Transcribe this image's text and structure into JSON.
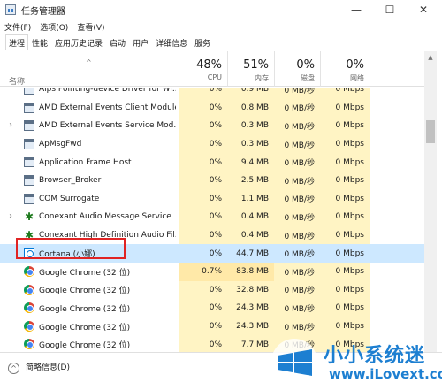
{
  "window": {
    "title": "任务管理器",
    "minimize_glyph": "—",
    "maximize_glyph": "☐",
    "close_glyph": "✕"
  },
  "menu": [
    "文件(F)",
    "选项(O)",
    "查看(V)"
  ],
  "tabs": [
    {
      "label": "进程",
      "active": true
    },
    {
      "label": "性能",
      "active": false
    },
    {
      "label": "应用历史记录",
      "active": false
    },
    {
      "label": "启动",
      "active": false
    },
    {
      "label": "用户",
      "active": false
    },
    {
      "label": "详细信息",
      "active": false
    },
    {
      "label": "服务",
      "active": false
    }
  ],
  "header": {
    "sort_glyph": "^",
    "name_label": "名称",
    "columns": [
      {
        "key": "cpu",
        "percent": "48%",
        "label": "CPU"
      },
      {
        "key": "mem",
        "percent": "51%",
        "label": "内存"
      },
      {
        "key": "disk",
        "percent": "0%",
        "label": "磁盘"
      },
      {
        "key": "net",
        "percent": "0%",
        "label": "网络"
      }
    ]
  },
  "processes": [
    {
      "name": "Alps Pointing-device Driver for Wi...",
      "expandable": false,
      "icon": "app-icon",
      "cpu": "0%",
      "mem": "0.9 MB",
      "disk": "0 MB/秒",
      "net": "0 Mbps",
      "selected": false
    },
    {
      "name": "AMD External Events Client Module",
      "expandable": false,
      "icon": "app-icon",
      "cpu": "0%",
      "mem": "0.8 MB",
      "disk": "0 MB/秒",
      "net": "0 Mbps",
      "selected": false
    },
    {
      "name": "AMD External Events Service Mod...",
      "expandable": true,
      "icon": "app-icon",
      "cpu": "0%",
      "mem": "0.3 MB",
      "disk": "0 MB/秒",
      "net": "0 Mbps",
      "selected": false
    },
    {
      "name": "ApMsgFwd",
      "expandable": false,
      "icon": "app-icon",
      "cpu": "0%",
      "mem": "0.3 MB",
      "disk": "0 MB/秒",
      "net": "0 Mbps",
      "selected": false
    },
    {
      "name": "Application Frame Host",
      "expandable": false,
      "icon": "app-icon",
      "cpu": "0%",
      "mem": "9.4 MB",
      "disk": "0 MB/秒",
      "net": "0 Mbps",
      "selected": false
    },
    {
      "name": "Browser_Broker",
      "expandable": false,
      "icon": "app-icon",
      "cpu": "0%",
      "mem": "2.5 MB",
      "disk": "0 MB/秒",
      "net": "0 Mbps",
      "selected": false
    },
    {
      "name": "COM Surrogate",
      "expandable": false,
      "icon": "app-icon",
      "cpu": "0%",
      "mem": "1.1 MB",
      "disk": "0 MB/秒",
      "net": "0 Mbps",
      "selected": false
    },
    {
      "name": "Conexant Audio Message Service",
      "expandable": true,
      "icon": "conexant-icon",
      "cpu": "0%",
      "mem": "0.4 MB",
      "disk": "0 MB/秒",
      "net": "0 Mbps",
      "selected": false
    },
    {
      "name": "Conexant High Definition Audio Fil...",
      "expandable": false,
      "icon": "conexant-icon",
      "cpu": "0%",
      "mem": "0.4 MB",
      "disk": "0 MB/秒",
      "net": "0 Mbps",
      "selected": false
    },
    {
      "name": "Cortana (小娜)",
      "expandable": false,
      "icon": "cortana-icon",
      "cpu": "0%",
      "mem": "44.7 MB",
      "disk": "0 MB/秒",
      "net": "0 Mbps",
      "selected": true
    },
    {
      "name": "Google Chrome (32 位)",
      "expandable": false,
      "icon": "chrome-icon",
      "cpu": "0.7%",
      "mem": "83.8 MB",
      "disk": "0 MB/秒",
      "net": "0 Mbps",
      "selected": false
    },
    {
      "name": "Google Chrome (32 位)",
      "expandable": false,
      "icon": "chrome-icon",
      "cpu": "0%",
      "mem": "32.8 MB",
      "disk": "0 MB/秒",
      "net": "0 Mbps",
      "selected": false
    },
    {
      "name": "Google Chrome (32 位)",
      "expandable": false,
      "icon": "chrome-icon",
      "cpu": "0%",
      "mem": "24.3 MB",
      "disk": "0 MB/秒",
      "net": "0 Mbps",
      "selected": false
    },
    {
      "name": "Google Chrome (32 位)",
      "expandable": false,
      "icon": "chrome-icon",
      "cpu": "0%",
      "mem": "24.3 MB",
      "disk": "0 MB/秒",
      "net": "0 Mbps",
      "selected": false
    },
    {
      "name": "Google Chrome (32 位)",
      "expandable": false,
      "icon": "chrome-icon",
      "cpu": "0%",
      "mem": "7.7 MB",
      "disk": "0 MB/秒",
      "net": "0 Mbps",
      "selected": false
    }
  ],
  "footer": {
    "fewer_details_glyph": "^",
    "fewer_details_label": "简略信息(D)"
  },
  "watermark": {
    "brand": "小小系统迷",
    "url": "www.iLovext.com"
  },
  "colors": {
    "selected_row": "#cde8ff",
    "heat_light": "#fff4c4",
    "heat_strong": "#ffe9a8",
    "highlight_box": "#e02424",
    "watermark_blue": "#1d7fd1"
  }
}
